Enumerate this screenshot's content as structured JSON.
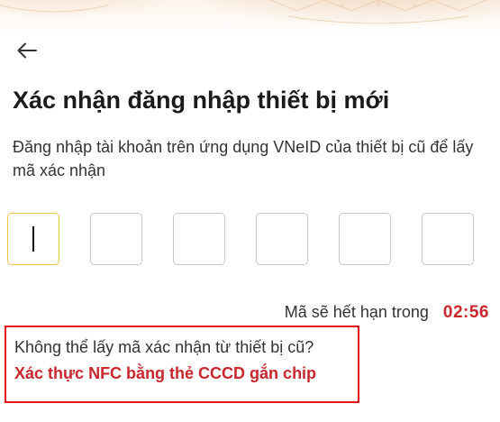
{
  "header": {
    "back_icon": "arrow-left-icon"
  },
  "page": {
    "title": "Xác nhận đăng nhập thiết bị mới",
    "description": "Đăng nhập tài khoản trên ứng dụng VNeID của thiết bị cũ để lấy mã xác nhận"
  },
  "otp": {
    "digits": [
      "",
      "",
      "",
      "",
      "",
      ""
    ],
    "active_index": 0
  },
  "timer": {
    "label": "Mã sẽ hết hạn trong",
    "value": "02:56"
  },
  "nfc": {
    "question": "Không thể lấy mã xác nhận từ thiết bị cũ?",
    "link_label": "Xác thực NFC bằng thẻ CCCD gắn chip"
  },
  "colors": {
    "accent_red": "#c8272d",
    "highlight_border": "#e8161c",
    "active_box_border": "#f1c548"
  }
}
